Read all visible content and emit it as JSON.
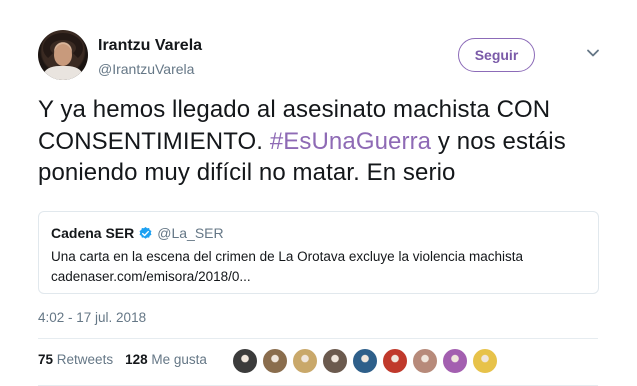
{
  "author": {
    "display_name": "Irantzu Varela",
    "handle": "@IrantzuVarela"
  },
  "follow_button": {
    "label": "Seguir"
  },
  "tweet": {
    "text_before": "Y ya hemos llegado al asesinato machista CON CONSENTIMIENTO. ",
    "hashtag": "#EsUnaGuerra",
    "text_after": " y nos estáis poniendo muy difícil no matar. En serio"
  },
  "quoted_tweet": {
    "display_name": "Cadena SER",
    "handle": "@La_SER",
    "text": "Una carta en la escena del crimen de La Orotava excluye la violencia machista",
    "link": "cadenaser.com/emisora/2018/0..."
  },
  "timestamp": "4:02 - 17 jul. 2018",
  "stats": {
    "retweets_count": "75",
    "retweets_label": "Retweets",
    "likes_count": "128",
    "likes_label": "Me gusta"
  },
  "colors": {
    "accent": "#8e6ab5",
    "verified": "#1da1f2",
    "secondary_text": "#657786"
  },
  "liker_avatars": [
    {
      "name": "liker-avatar-1",
      "color": "#3b3b3b"
    },
    {
      "name": "liker-avatar-2",
      "color": "#8a6d4d"
    },
    {
      "name": "liker-avatar-3",
      "color": "#c9a86a"
    },
    {
      "name": "liker-avatar-4",
      "color": "#6b5a4e"
    },
    {
      "name": "liker-avatar-5",
      "color": "#2e5f8a"
    },
    {
      "name": "liker-avatar-6",
      "color": "#c0392b"
    },
    {
      "name": "liker-avatar-7",
      "color": "#b78a7a"
    },
    {
      "name": "liker-avatar-8",
      "color": "#a35fb0"
    },
    {
      "name": "liker-avatar-9",
      "color": "#e7c24a"
    }
  ]
}
